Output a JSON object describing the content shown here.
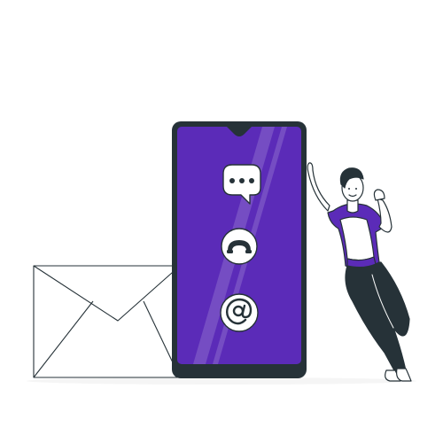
{
  "illustration": {
    "colors": {
      "phone_screen": "#5b2bb8",
      "phone_frame": "#263238",
      "shirt": "#5b2bb8",
      "pants": "#263238",
      "skin": "#ffffff",
      "outline": "#263238",
      "ground": "#f5f5f5"
    },
    "icons": [
      "chat-bubble-icon",
      "phone-call-icon",
      "at-sign-icon",
      "envelope-icon"
    ]
  }
}
